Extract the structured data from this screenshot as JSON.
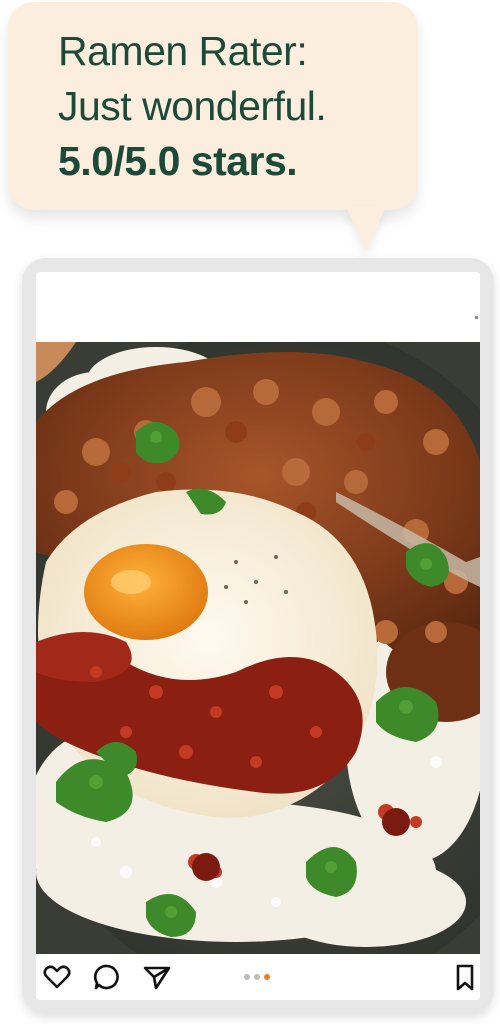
{
  "bubble": {
    "line1": "Ramen Rater:",
    "line2": "Just wonderful.",
    "rating": "5.0/5.0 stars."
  },
  "post": {
    "image_alt": "Bowl of rice topped with spiced minced meat, a fried egg with chili crisp, and cilantro",
    "carousel": {
      "count": 3,
      "active_index": 2
    }
  },
  "icons": {
    "like": "heart-icon",
    "comment": "comment-icon",
    "share": "send-icon",
    "save": "bookmark-icon"
  },
  "colors": {
    "bubble_bg": "#fbeedf",
    "bubble_text": "#1d4a38",
    "active_dot": "#f07a2a"
  }
}
